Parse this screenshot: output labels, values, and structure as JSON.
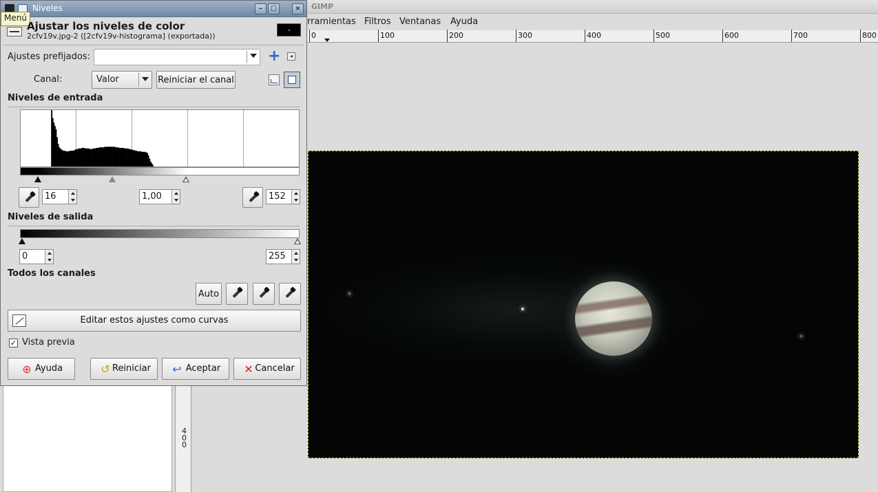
{
  "gimp": {
    "title": "GIMP",
    "menus": [
      "rramientas",
      "Filtros",
      "Ventanas",
      "Ayuda"
    ],
    "ruler_labels": [
      "0",
      "100",
      "200",
      "300",
      "400",
      "500",
      "600",
      "700",
      "800"
    ],
    "vruler_labels": [
      "4",
      "0",
      "0"
    ]
  },
  "dialog": {
    "window_title": "Niveles",
    "menu_tooltip": "Menú",
    "heading": "Ajustar los niveles de color",
    "subheading": "2cfv19v.jpg-2 ([2cfv19v-histograma] (exportada))",
    "presets_label": "Ajustes prefijados:",
    "presets_value": "",
    "channel_label": "Canal:",
    "channel_value": "Valor",
    "reset_channel_button": "Reiniciar el canal",
    "input_levels_title": "Niveles de entrada",
    "input_low": "16",
    "input_gamma": "1,00",
    "input_high": "152",
    "output_levels_title": "Niveles de salida",
    "output_low": "0",
    "output_high": "255",
    "all_channels_title": "Todos los canales",
    "auto_button": "Auto",
    "edit_curves_button": "Editar estos ajustes como curvas",
    "preview_label": "Vista previa",
    "preview_checked": true,
    "buttons": {
      "help": "Ayuda",
      "reset": "Reiniciar",
      "ok": "Aceptar",
      "cancel": "Cancelar"
    }
  },
  "histogram": {
    "bins": [
      0,
      0,
      0,
      0,
      0,
      0,
      0,
      0,
      0,
      0,
      0,
      0,
      0,
      0,
      0,
      0,
      0,
      0,
      0,
      0,
      0,
      0,
      0,
      0,
      0,
      0,
      0,
      0,
      100,
      86,
      78,
      72,
      66,
      52,
      40,
      34,
      32,
      30,
      29,
      28,
      28,
      27,
      27,
      27,
      27,
      28,
      28,
      28,
      28,
      29,
      30,
      31,
      31,
      32,
      32,
      32,
      33,
      33,
      33,
      32,
      32,
      32,
      32,
      31,
      31,
      31,
      32,
      32,
      32,
      33,
      33,
      33,
      34,
      34,
      34,
      34,
      34,
      35,
      35,
      35,
      35,
      35,
      35,
      35,
      35,
      35,
      35,
      34,
      34,
      34,
      33,
      33,
      33,
      33,
      33,
      32,
      32,
      32,
      32,
      31,
      31,
      30,
      30,
      29,
      29,
      28,
      28,
      27,
      27,
      27,
      27,
      26,
      26,
      26,
      26,
      25,
      24,
      20,
      14,
      9,
      6,
      3,
      0
    ],
    "colors": {
      "bar": "#000000"
    }
  }
}
